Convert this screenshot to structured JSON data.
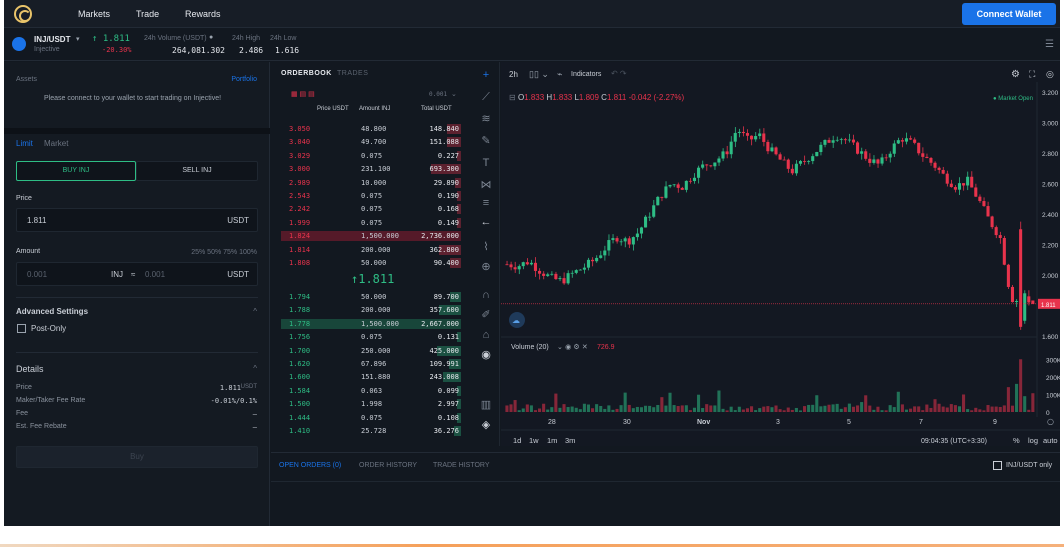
{
  "nav": {
    "items": [
      "Markets",
      "Trade",
      "Rewards"
    ],
    "connect": "Connect Wallet"
  },
  "ticker": {
    "pair": "INJ/USDT",
    "sub": "Injective",
    "price": "1.811",
    "change": "-20.30%",
    "vol_label": "24h Volume (USDT)",
    "vol": "264,081.302",
    "high_label": "24h High",
    "high": "2.486",
    "low_label": "24h Low",
    "low": "1.616"
  },
  "assets": {
    "title": "Assets",
    "portfolio": "Portfolio",
    "msg": "Please connect to your wallet to start trading on Injective!"
  },
  "form": {
    "tabs": [
      "Limit",
      "Market"
    ],
    "buy": "BUY INJ",
    "sell": "SELL INJ",
    "price_label": "Price",
    "price_value": "1.811",
    "price_unit": "USDT",
    "amount_label": "Amount",
    "pcts": "25% 50% 75% 100%",
    "amount_ph": "0.001",
    "amount_unit": "INJ",
    "approx": "≈",
    "total_ph": "0.001",
    "total_unit": "USDT",
    "adv": "Advanced Settings",
    "post_only": "Post-Only"
  },
  "details": {
    "title": "Details",
    "rows": [
      {
        "k": "Price",
        "v": "1.811",
        "u": "USDT"
      },
      {
        "k": "Maker/Taker Fee Rate",
        "v": "-0.01%/0.1%",
        "u": ""
      },
      {
        "k": "Fee",
        "v": "—",
        "u": ""
      },
      {
        "k": "Est. Fee Rebate",
        "v": "—",
        "u": ""
      }
    ],
    "buy_btn": "Buy"
  },
  "orderbook": {
    "tabs": [
      "ORDERBOOK",
      "TRADES"
    ],
    "tick": "0.001",
    "headers": [
      "Price USDT",
      "Amount INJ",
      "Total USDT"
    ],
    "asks": [
      [
        "3.050",
        "48.800",
        "148.840"
      ],
      [
        "3.040",
        "49.700",
        "151.088"
      ],
      [
        "3.029",
        "0.075",
        "0.227"
      ],
      [
        "3.000",
        "231.100",
        "693.300"
      ],
      [
        "2.989",
        "10.000",
        "29.890"
      ],
      [
        "2.543",
        "0.075",
        "0.190"
      ],
      [
        "2.242",
        "0.075",
        "0.168"
      ],
      [
        "1.999",
        "0.075",
        "0.149"
      ],
      [
        "1.824",
        "1,500.000",
        "2,736.000"
      ],
      [
        "1.814",
        "200.000",
        "362.800"
      ],
      [
        "1.808",
        "50.000",
        "90.400"
      ]
    ],
    "mid": "↑1.811",
    "bids": [
      [
        "1.794",
        "50.000",
        "89.700"
      ],
      [
        "1.788",
        "200.000",
        "357.600"
      ],
      [
        "1.778",
        "1,500.000",
        "2,667.000"
      ],
      [
        "1.756",
        "0.075",
        "0.131"
      ],
      [
        "1.700",
        "250.000",
        "425.000"
      ],
      [
        "1.620",
        "67.896",
        "109.991"
      ],
      [
        "1.600",
        "151.880",
        "243.008"
      ],
      [
        "1.584",
        "0.063",
        "0.099"
      ],
      [
        "1.500",
        "1.998",
        "2.997"
      ],
      [
        "1.444",
        "0.075",
        "0.108"
      ],
      [
        "1.410",
        "25.728",
        "36.276"
      ]
    ]
  },
  "chart": {
    "interval": "2h",
    "indicators": "Indicators",
    "ohlc": {
      "o_label": "O",
      "o": "1.833",
      "h_label": "H",
      "h": "1.833",
      "l_label": "L",
      "l": "1.809",
      "c_label": "C",
      "c": "1.811",
      "chg": "-0.042 (-2.27%)"
    },
    "market_open": "● Market Open",
    "volume_label": "Volume (20)",
    "volume_value": "726.9",
    "yticks": [
      "3.200",
      "3.000",
      "2.800",
      "2.600",
      "2.400",
      "2.200",
      "2.000",
      "1.800",
      "1.600"
    ],
    "vticks": [
      "300K",
      "200K",
      "100K",
      "0"
    ],
    "xticks": [
      "28",
      "30",
      "Nov",
      "3",
      "5",
      "7",
      "9"
    ],
    "current_price": "1.811",
    "ranges": [
      "1d",
      "1w",
      "1m",
      "3m"
    ],
    "time": "09:04:35 (UTC+3:30)",
    "pct": "%",
    "log": "log",
    "auto": "auto"
  },
  "bottom": {
    "tabs": [
      "OPEN ORDERS (0)",
      "ORDER HISTORY",
      "TRADE HISTORY"
    ],
    "only": "INJ/USDT only"
  },
  "colors": {
    "green": "#2ebd85",
    "red": "#e8334c",
    "blue": "#1a73e8"
  }
}
